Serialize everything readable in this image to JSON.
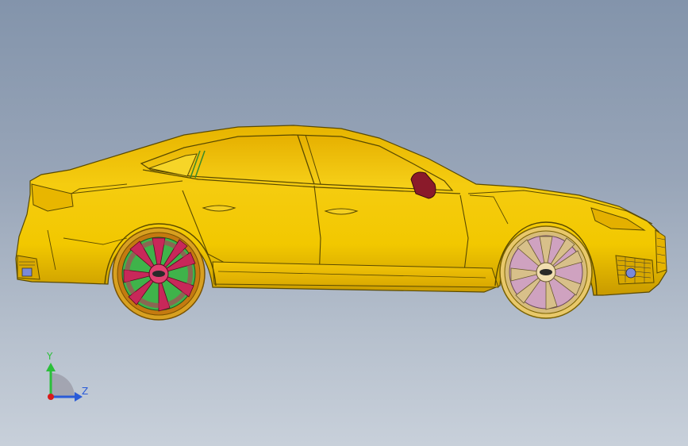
{
  "viewport": {
    "background_top": "#8394ab",
    "background_bottom": "#c8d0da"
  },
  "model": {
    "name": "car-side-view",
    "body_color": "#f0c400",
    "outline_color": "#5a4a00",
    "rear_wheel_spoke_color": "#c8285a",
    "rear_wheel_accent_color": "#3fb34a",
    "front_wheel_spoke_color": "#d8c08a",
    "mirror_color": "#8a1a2a",
    "light_accent_color": "#7a8ad8"
  },
  "triad": {
    "y_label": "Y",
    "z_label": "Z",
    "y_color": "#2bbf3a",
    "z_color": "#2a5bd8",
    "x_color": "#d81a1a"
  }
}
